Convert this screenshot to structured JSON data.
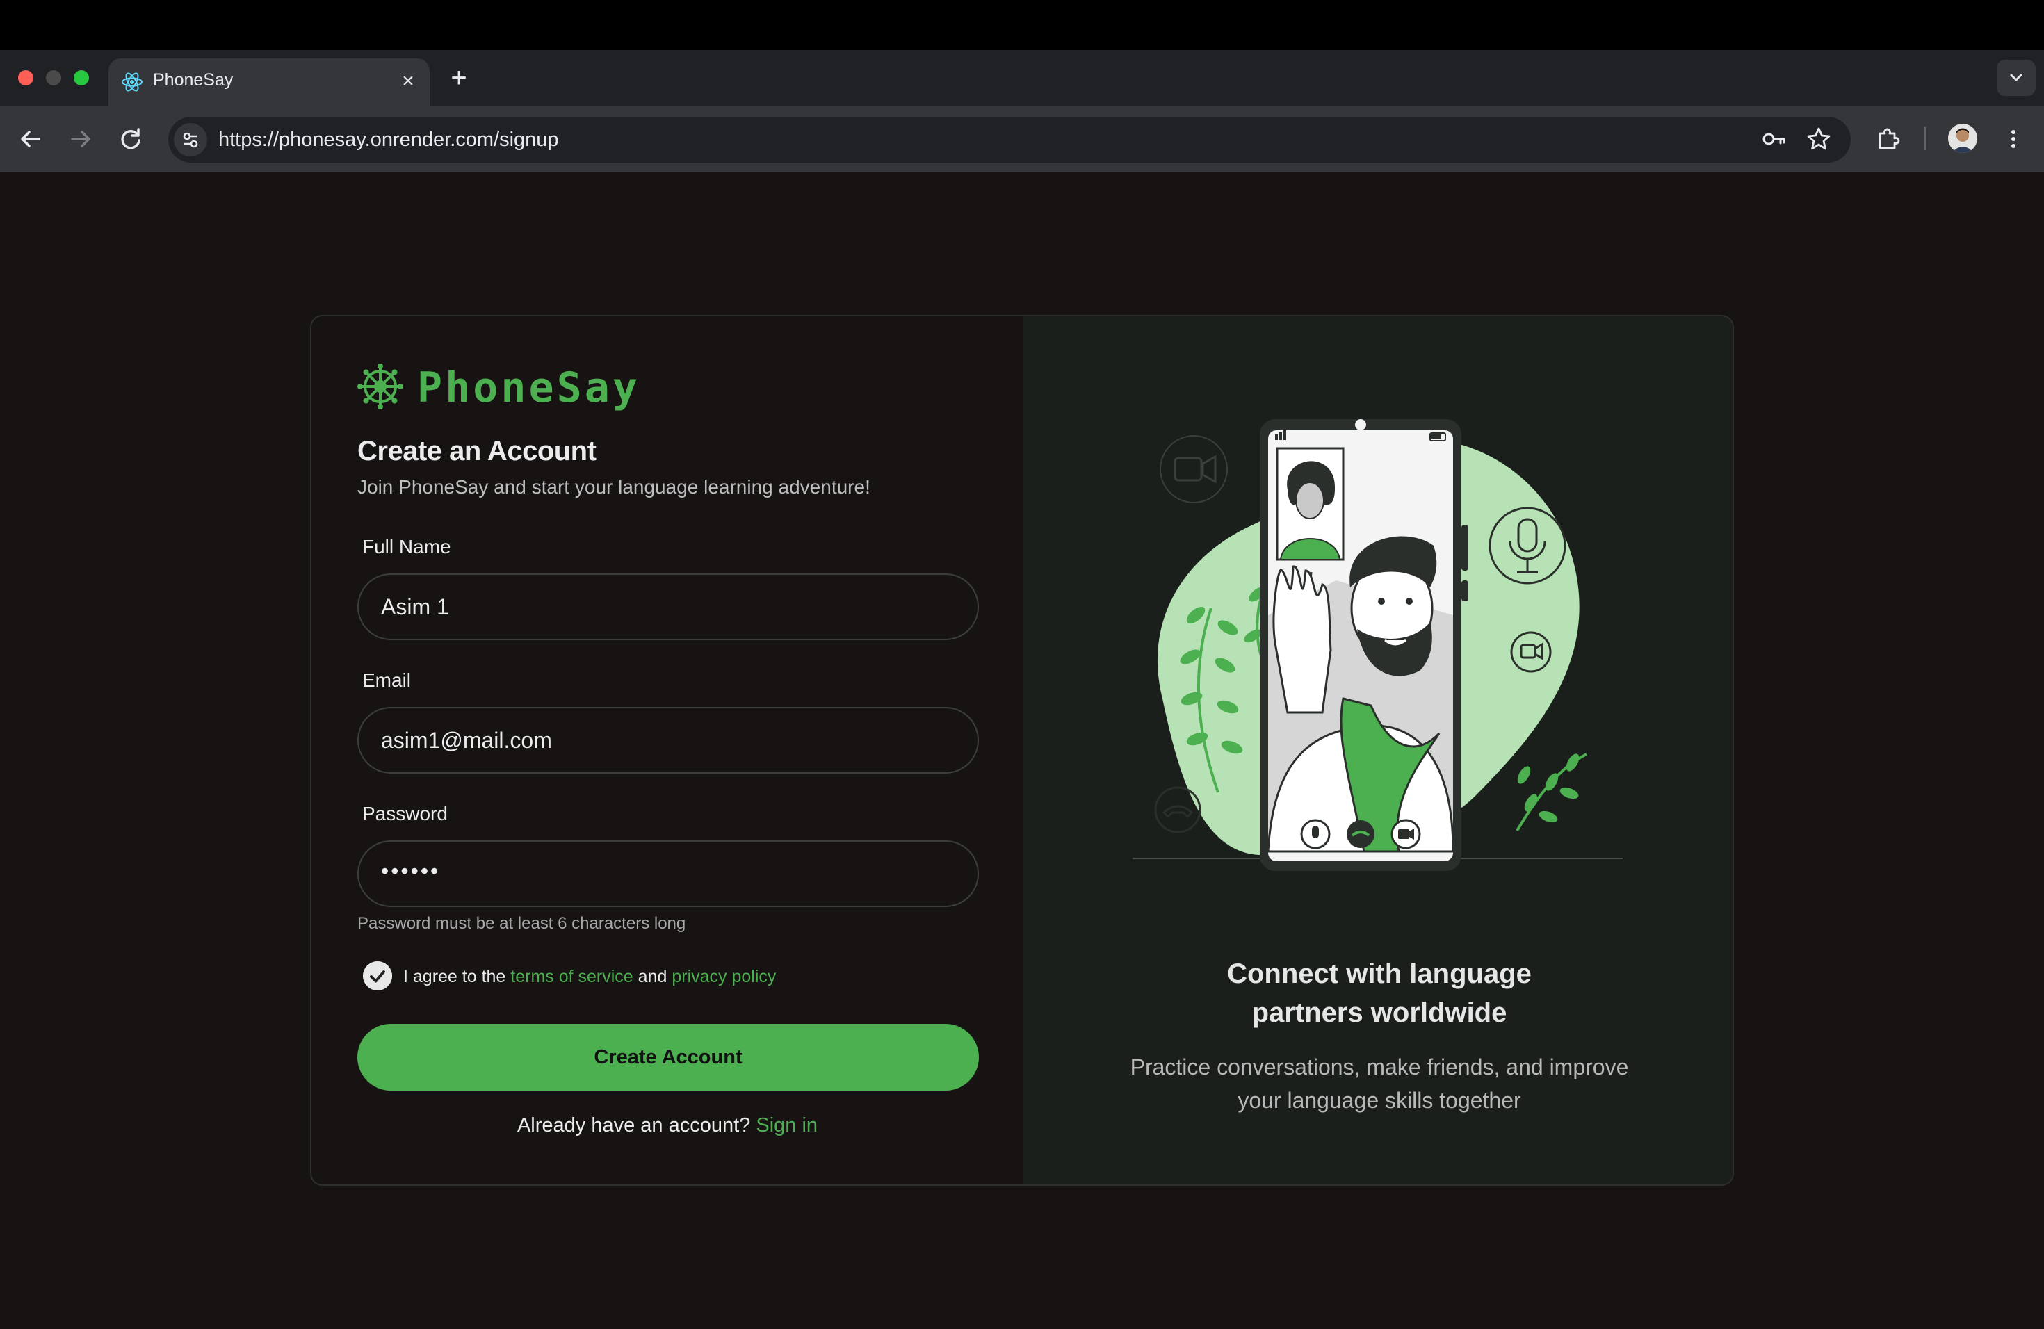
{
  "browser": {
    "tab_title": "PhoneSay",
    "url": "https://phonesay.onrender.com/signup"
  },
  "brand": {
    "name": "PhoneSay",
    "accent": "#4caf50"
  },
  "signup": {
    "heading": "Create an Account",
    "subheading": "Join PhoneSay and start your language learning adventure!",
    "full_name": {
      "label": "Full Name",
      "value": "Asim 1"
    },
    "email": {
      "label": "Email",
      "value": "asim1@mail.com"
    },
    "password": {
      "label": "Password",
      "value": "••••••",
      "hint": "Password must be at least 6 characters long"
    },
    "agree": {
      "prefix": "I agree to the",
      "terms": "terms of service",
      "and": "and",
      "privacy": "privacy policy",
      "checked": true
    },
    "submit_label": "Create Account",
    "signin_prompt": "Already have an account?",
    "signin_link": "Sign in"
  },
  "promo": {
    "title": "Connect with language partners worldwide",
    "subtitle": "Practice conversations, make friends, and improve your language skills together"
  }
}
